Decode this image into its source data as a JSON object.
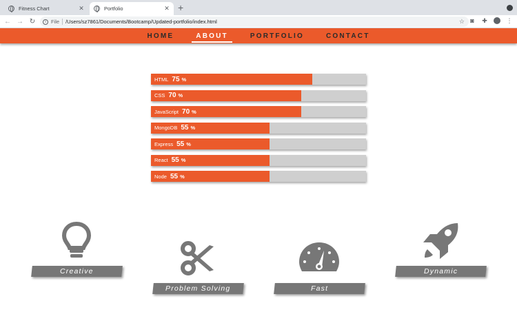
{
  "browser": {
    "tabs": [
      {
        "title": "Fitness Chart",
        "active": false
      },
      {
        "title": "Portfolio",
        "active": true
      }
    ],
    "address": {
      "scheme": "File",
      "url": "/Users/sz7861/Documents/Bootcamp/Updated-portfolio/index.html"
    }
  },
  "nav": {
    "items": [
      "HOME",
      "ABOUT",
      "PORTFOLIO",
      "CONTACT"
    ],
    "active": "ABOUT",
    "color": "#eb5a2b"
  },
  "skills": [
    {
      "name": "HTML",
      "percent": 75,
      "display": "75",
      "unit": "%"
    },
    {
      "name": "CSS",
      "percent": 70,
      "display": "70",
      "unit": "%"
    },
    {
      "name": "JavaScript",
      "percent": 70,
      "display": "70",
      "unit": "%"
    },
    {
      "name": "MongoDB",
      "percent": 55,
      "display": "55",
      "unit": "%"
    },
    {
      "name": "Express",
      "percent": 55,
      "display": "55",
      "unit": "%"
    },
    {
      "name": "React",
      "percent": 55,
      "display": "55",
      "unit": "%"
    },
    {
      "name": "Node",
      "percent": 55,
      "display": "55",
      "unit": "%"
    }
  ],
  "traits": [
    {
      "label": "Creative",
      "icon": "lightbulb-icon"
    },
    {
      "label": "Problem Solving",
      "icon": "scissors-icon"
    },
    {
      "label": "Fast",
      "icon": "speedometer-icon"
    },
    {
      "label": "Dynamic",
      "icon": "rocket-icon"
    }
  ],
  "colors": {
    "accent": "#eb5a2b",
    "track": "#cfcfcf",
    "badge": "#777777"
  }
}
